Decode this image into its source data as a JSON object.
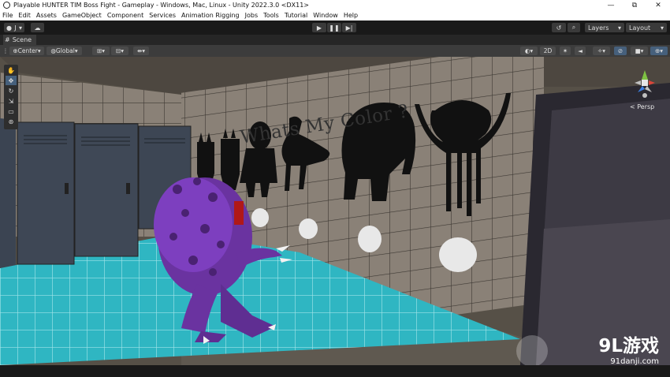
{
  "window": {
    "title": "Playable HUNTER TIM Boss Fight - Gameplay - Windows, Mac, Linux - Unity 2022.3.0 <DX11>",
    "minimize": "—",
    "maximize": "⧉",
    "close": "✕"
  },
  "menu": [
    "File",
    "Edit",
    "Assets",
    "GameObject",
    "Component",
    "Services",
    "Animation Rigging",
    "Jobs",
    "Tools",
    "Tutorial",
    "Window",
    "Help"
  ],
  "toolbar": {
    "account_label": "J",
    "layers_label": "Layers",
    "layout_label": "Layout"
  },
  "scene_tab": {
    "label": "Scene"
  },
  "scene_toolbar": {
    "pivot_label": "Center",
    "space_label": "Global",
    "mode_2d_label": "2D"
  },
  "viewport": {
    "wall_text": "Whats My Color ?",
    "projection_label": "< Persp"
  },
  "watermark": {
    "logo": "9L游戏",
    "url": "91danji.com"
  }
}
